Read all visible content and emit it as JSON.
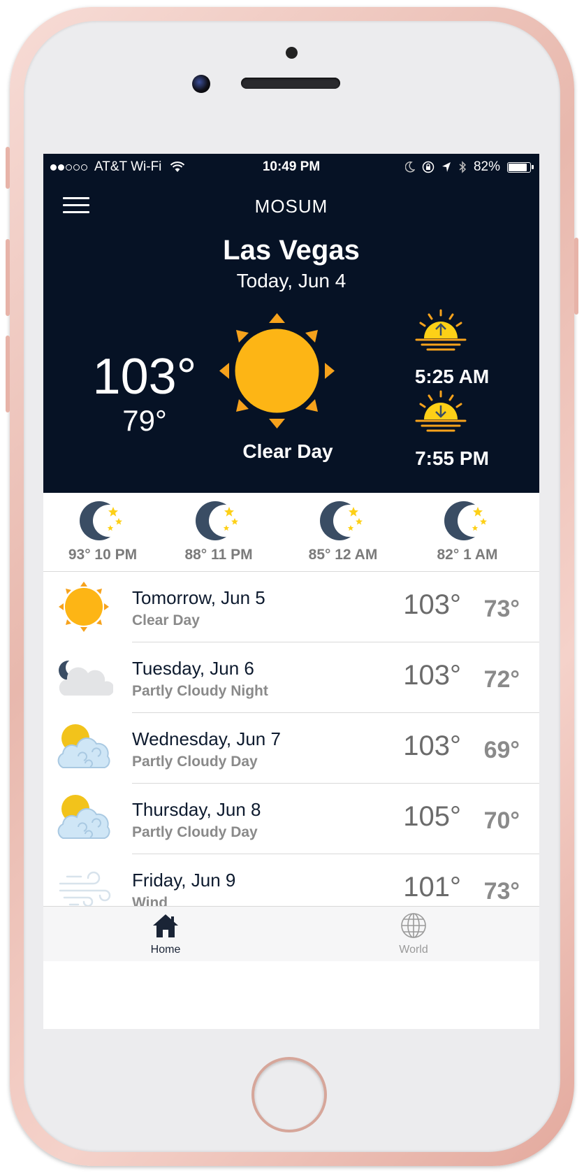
{
  "status_bar": {
    "carrier": "AT&T Wi-Fi",
    "time": "10:49 PM",
    "battery": "82%",
    "signal_bars_filled": 2,
    "signal_bars_total": 5
  },
  "app": {
    "title": "MOSUM"
  },
  "current": {
    "city": "Las Vegas",
    "date": "Today, Jun 4",
    "high": "103°",
    "low": "79°",
    "condition": "Clear Day",
    "sunrise": "5:25 AM",
    "sunset": "7:55 PM",
    "icon": "sun-icon"
  },
  "hourly": [
    {
      "temp": "93°",
      "time": "10 PM",
      "label": "93° 10 PM",
      "icon": "moon-stars-icon"
    },
    {
      "temp": "88°",
      "time": "11 PM",
      "label": "88° 11 PM",
      "icon": "moon-stars-icon"
    },
    {
      "temp": "85°",
      "time": "12 AM",
      "label": "85° 12 AM",
      "icon": "moon-stars-icon"
    },
    {
      "temp": "82°",
      "time": "1 AM",
      "label": "82° 1 AM",
      "icon": "moon-stars-icon"
    }
  ],
  "daily": [
    {
      "day": "Tomorrow, Jun 5",
      "condition": "Clear Day",
      "high": "103°",
      "low": "73°",
      "icon": "sun-icon"
    },
    {
      "day": "Tuesday, Jun 6",
      "condition": "Partly Cloudy Night",
      "high": "103°",
      "low": "72°",
      "icon": "partly-cloudy-night-icon"
    },
    {
      "day": "Wednesday, Jun 7",
      "condition": "Partly Cloudy Day",
      "high": "103°",
      "low": "69°",
      "icon": "partly-cloudy-day-icon"
    },
    {
      "day": "Thursday, Jun 8",
      "condition": "Partly Cloudy Day",
      "high": "105°",
      "low": "70°",
      "icon": "partly-cloudy-day-icon"
    },
    {
      "day": "Friday, Jun 9",
      "condition": "Wind",
      "high": "101°",
      "low": "73°",
      "icon": "wind-icon"
    }
  ],
  "tabs": [
    {
      "label": "Home",
      "icon": "home-icon",
      "active": true
    },
    {
      "label": "World",
      "icon": "globe-icon",
      "active": false
    }
  ],
  "colors": {
    "header_bg": "#061225",
    "sun": "#fdb515",
    "sun_rays": "#f6a21c",
    "moon": "#3a4d64",
    "text_gray": "#8a8a8a"
  }
}
